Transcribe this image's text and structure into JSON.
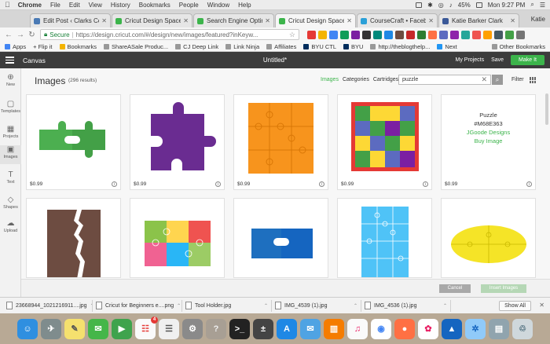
{
  "menubar": {
    "apple": "",
    "items": [
      "Chrome",
      "File",
      "Edit",
      "View",
      "History",
      "Bookmarks",
      "People",
      "Window",
      "Help"
    ],
    "battery": "45%",
    "clock": "Mon 9:27 PM"
  },
  "tabs": [
    {
      "title": "Edit Post ‹ Clarks Co",
      "color": "#4a7ab5",
      "active": false
    },
    {
      "title": "Cricut Design Space",
      "color": "#3cb44b",
      "active": false
    },
    {
      "title": "Search Engine Optimiz",
      "color": "#3cb44b",
      "active": false
    },
    {
      "title": "Cricut Design Space",
      "color": "#3cb44b",
      "active": true
    },
    {
      "title": "CourseCraft • Facebo",
      "color": "#2aa0d8",
      "active": false
    },
    {
      "title": "Katie Barker Clark",
      "color": "#3b5998",
      "active": false
    }
  ],
  "profile": "Katie",
  "address": {
    "secure_label": "Secure",
    "url": "https://design.cricut.com/#/design/new/images/featured?inKeyw..."
  },
  "bookmarks": {
    "items": [
      "Apps",
      "+ Flip it",
      "Bookmarks",
      "ShareASale Produc...",
      "CJ Deep Link",
      "Link Ninja",
      "Affiliates",
      "BYU CTL",
      "BYU",
      "http://theblogthelp...",
      "Next"
    ],
    "other": "Other Bookmarks"
  },
  "app_header": {
    "canvas": "Canvas",
    "doc_title": "Untitled*",
    "my_projects": "My Projects",
    "save": "Save",
    "make_it": "Make It"
  },
  "rail": [
    "New",
    "Templates",
    "Projects",
    "Images",
    "Text",
    "Shapes",
    "Upload"
  ],
  "images": {
    "title": "Images",
    "count": "(296 results)",
    "filters": [
      "Images",
      "Categories",
      "Cartridges"
    ],
    "search_value": "puzzle",
    "filter_label": "Filter"
  },
  "cards": [
    {
      "price": "$0.99"
    },
    {
      "price": "$0.99"
    },
    {
      "price": "$0.99"
    },
    {
      "price": "$0.99"
    },
    {
      "price": "$0.99",
      "text": {
        "name": "Puzzle",
        "id": "#M68E363",
        "designer": "JGoode Designs",
        "buy": "Buy Image"
      }
    },
    {},
    {},
    {},
    {},
    {}
  ],
  "footer": {
    "cancel": "Cancel",
    "insert": "Insert Images"
  },
  "downloads": {
    "items": [
      "23668944_1021216911....jpg",
      "Cricut for Beginners e....png",
      "Tool Holder.jpg",
      "IMG_4539 (1).jpg",
      "IMG_4536 (1).jpg"
    ],
    "show_all": "Show All"
  },
  "dock": {
    "calendar_badge": "4",
    "icons": [
      "finder-icon",
      "launchpad-icon",
      "notes-icon",
      "messages-icon",
      "facetime-icon",
      "calendar-icon",
      "reminders-icon",
      "preferences-icon",
      "help-icon",
      "terminal-icon",
      "calculator-icon",
      "appstore-icon",
      "mail-icon",
      "books-icon",
      "music-icon",
      "chrome-icon",
      "firefox-icon",
      "photos-icon",
      "keynote-icon",
      "safari-icon",
      "folder-icon",
      "trash-icon"
    ]
  }
}
